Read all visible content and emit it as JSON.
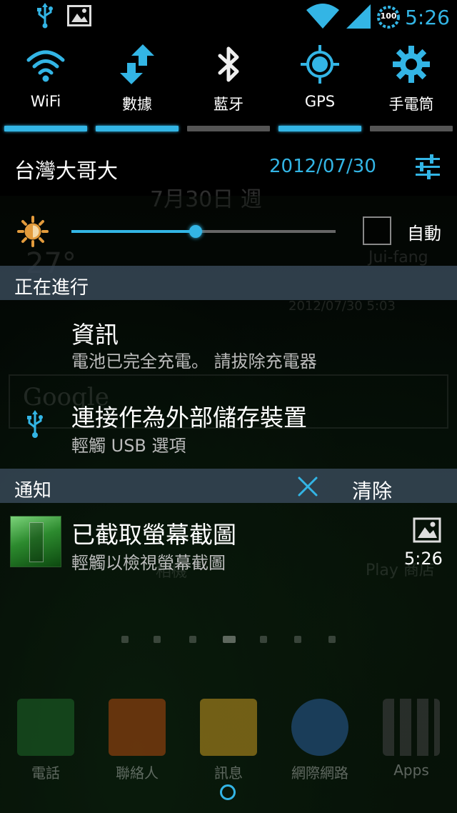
{
  "status_bar": {
    "time": "5:26",
    "battery_level": "100",
    "left_icons": [
      "usb-icon",
      "image-icon"
    ],
    "right_icons": [
      "wifi-signal-icon",
      "cell-signal-icon",
      "battery-icon"
    ]
  },
  "quick_toggles": [
    {
      "label": "WiFi",
      "icon": "wifi-icon",
      "enabled": true
    },
    {
      "label": "數據",
      "icon": "mobile-data-icon",
      "enabled": true
    },
    {
      "label": "藍牙",
      "icon": "bluetooth-icon",
      "enabled": false
    },
    {
      "label": "GPS",
      "icon": "gps-icon",
      "enabled": true
    },
    {
      "label": "手電筒",
      "icon": "flashlight-icon",
      "enabled": false
    }
  ],
  "header": {
    "carrier": "台灣大哥大",
    "date": "2012/07/30",
    "settings_icon": "settings-sliders-icon"
  },
  "brightness": {
    "level_fraction": 0.47,
    "auto_label": "自動",
    "auto_checked": false
  },
  "ongoing": {
    "header": "正在進行",
    "items": [
      {
        "title": "資訊",
        "subtitle": "電池已完全充電。 請拔除充電器",
        "icon": ""
      },
      {
        "title": "連接作為外部儲存裝置",
        "subtitle": "輕觸 USB 選項",
        "icon": "usb-icon"
      }
    ]
  },
  "notifications": {
    "header": "通知",
    "clear_label": "清除",
    "items": [
      {
        "title": "已截取螢幕截圖",
        "subtitle": "輕觸以檢視螢幕截圖",
        "time": "5:26",
        "icon": "image-icon"
      }
    ]
  },
  "background_ghost_text": {
    "weather_date": "7月30日 週",
    "temperature": "27°",
    "location": "Jui-fang",
    "updated": "2012/07/30 5:03",
    "search_logo": "Google",
    "play_store": "Play 商店",
    "camera": "相機"
  },
  "dock": {
    "items": [
      {
        "label": "電話",
        "icon": "phone-icon",
        "color": "#1f6a2a"
      },
      {
        "label": "聯絡人",
        "icon": "contacts-icon",
        "color": "#b04a10"
      },
      {
        "label": "訊息",
        "icon": "messages-icon",
        "color": "#c99a20"
      },
      {
        "label": "網際網路",
        "icon": "globe-icon",
        "color": "#2a5f9a"
      },
      {
        "label": "Apps",
        "icon": "apps-grid-icon",
        "color": "#444444"
      }
    ]
  },
  "colors": {
    "accent": "#33b5e5",
    "section_header": "#364654"
  }
}
